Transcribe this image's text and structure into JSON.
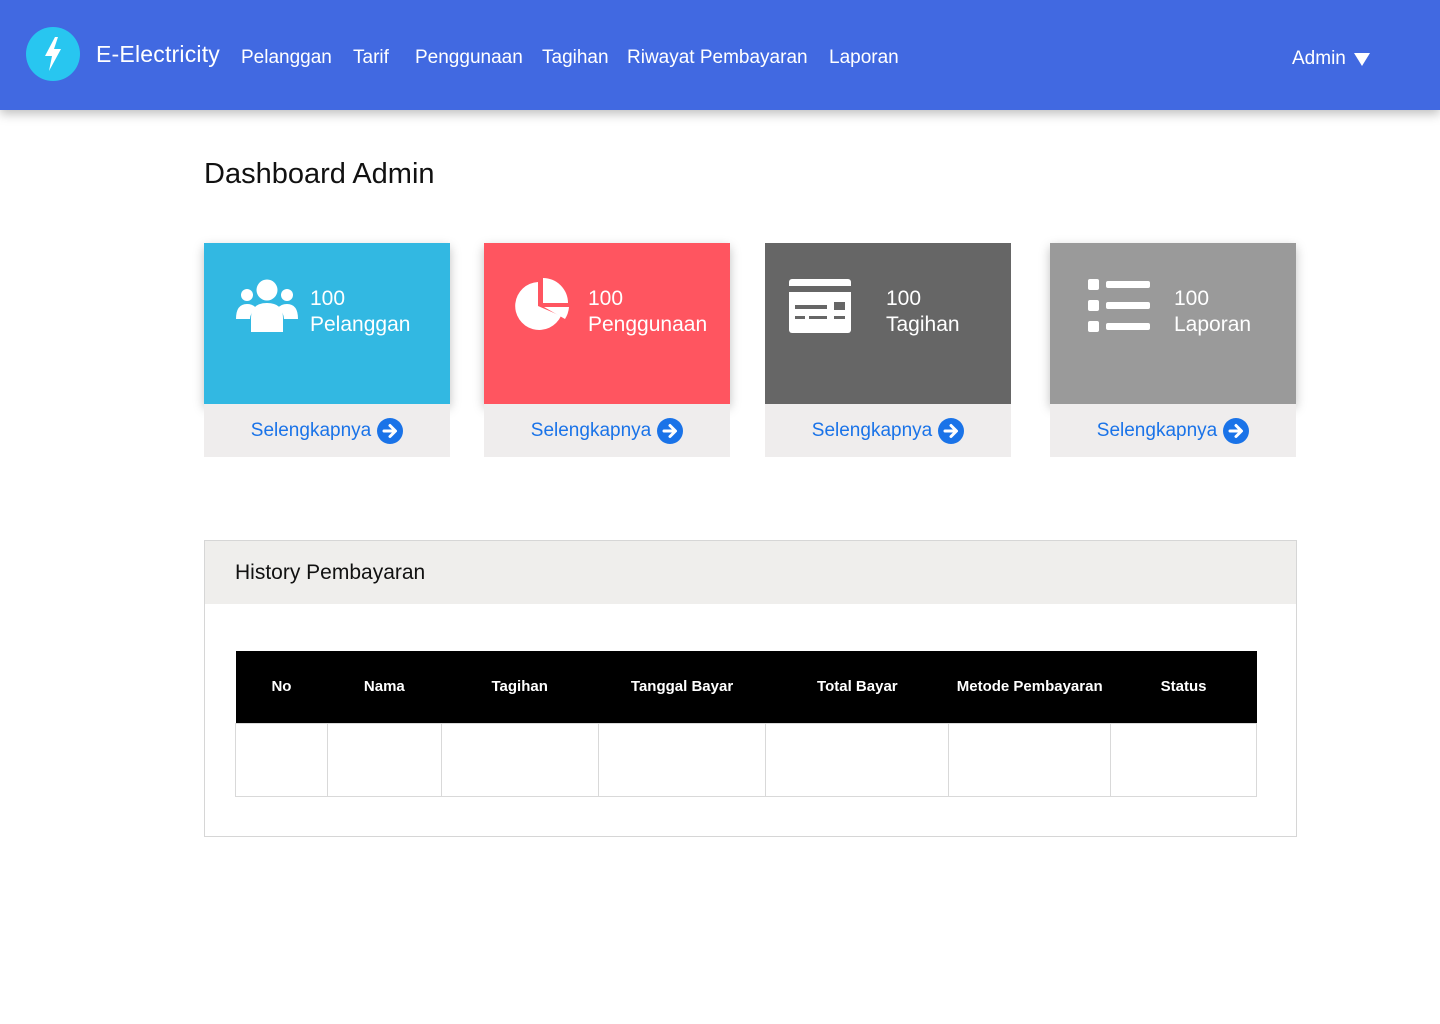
{
  "app": {
    "brand": "E-Electricity",
    "logo_icon": "lightning-bolt-icon",
    "nav_color": "#4169e1"
  },
  "nav": {
    "items": [
      "Pelanggan",
      "Tarif",
      "Penggunaan",
      "Tagihan",
      "Riwayat Pembayaran",
      "Laporan"
    ],
    "user_label": "Admin",
    "user_menu_icon": "caret-down-icon"
  },
  "page": {
    "title": "Dashboard Admin"
  },
  "cards": [
    {
      "count": "100",
      "label": "Pelanggan",
      "icon": "users-icon",
      "color": "#32b8e2",
      "more": "Selengkapnya"
    },
    {
      "count": "100",
      "label": "Penggunaan",
      "icon": "pie-chart-icon",
      "color": "#ff5560",
      "more": "Selengkapnya"
    },
    {
      "count": "100",
      "label": "Tagihan",
      "icon": "invoice-card-icon",
      "color": "#666666",
      "more": "Selengkapnya"
    },
    {
      "count": "100",
      "label": "Laporan",
      "icon": "list-icon",
      "color": "#9a9a9a",
      "more": "Selengkapnya"
    }
  ],
  "history": {
    "title": "History Pembayaran",
    "columns": [
      "No",
      "Nama",
      "Tagihan",
      "Tanggal Bayar",
      "Total Bayar",
      "Metode Pembayaran",
      "Status"
    ],
    "rows": [
      [
        "",
        "",
        "",
        "",
        "",
        "",
        ""
      ]
    ]
  }
}
